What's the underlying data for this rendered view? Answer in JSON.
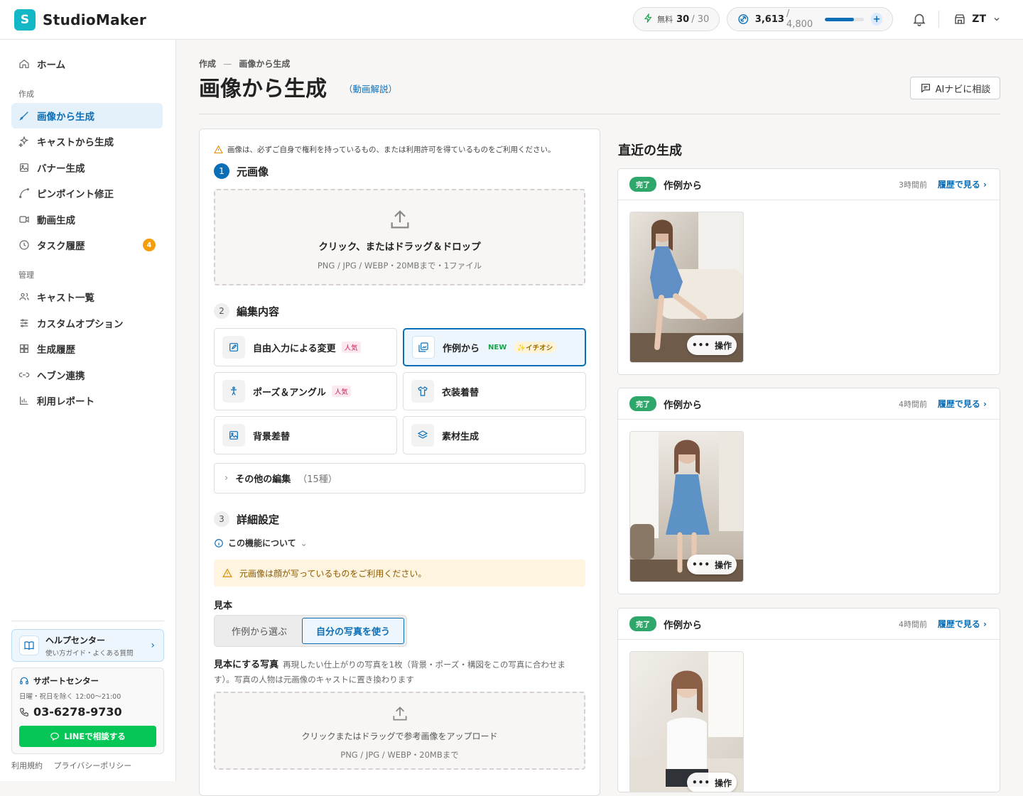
{
  "header": {
    "logo_letter": "S",
    "app_name": "StudioMaker",
    "free_label": "無料",
    "free_used": "30",
    "free_total": "/ 30",
    "credits": "3,613",
    "credits_total": "/ 4,800",
    "credits_fraction": 0.753,
    "user_initials": "ZT"
  },
  "sidebar": {
    "home": "ホーム",
    "section_create": "作成",
    "create_items": [
      "画像から生成",
      "キャストから生成",
      "バナー生成",
      "ピンポイント修正",
      "動画生成",
      "タスク履歴"
    ],
    "task_badge": "4",
    "section_manage": "管理",
    "manage_items": [
      "キャスト一覧",
      "カスタムオプション",
      "生成履歴",
      "ヘブン連携",
      "利用レポート"
    ],
    "help_title": "ヘルプセンター",
    "help_sub": "使い方ガイド・よくある質問",
    "support_title": "サポートセンター",
    "support_hours": "日曜・祝日を除く 12:00〜21:00",
    "support_phone": "03-6278-9730",
    "line_button": "LINEで相談する",
    "footer_terms": "利用規約",
    "footer_privacy": "プライバシーポリシー"
  },
  "page": {
    "breadcrumb_parent": "作成",
    "breadcrumb_sep": "—",
    "breadcrumb_current": "画像から生成",
    "title": "画像から生成",
    "video_link": "（動画解説）",
    "ai_button": "AIナビに相談"
  },
  "form": {
    "notice": "画像は、必ずご自身で権利を持っているもの、または利用許可を得ているものをご利用ください。",
    "step1_num": "1",
    "step1_title": "元画像",
    "dz1_main": "クリック、またはドラッグ＆ドロップ",
    "dz1_sub": "PNG / JPG / WEBP・20MBまで・1ファイル",
    "step2_num": "2",
    "step2_title": "編集内容",
    "opt_free": "自由入力による変更",
    "opt_example": "作例から",
    "opt_pose": "ポーズ＆アングル",
    "opt_outfit": "衣装着替",
    "opt_bg": "背景差替",
    "opt_material": "素材生成",
    "tag_popular": "人気",
    "tag_new": "NEW",
    "tag_pick": "✨イチオシ",
    "more_label": "その他の編集",
    "more_count": "（15種）",
    "step3_num": "3",
    "step3_title": "詳細設定",
    "about": "この機能について",
    "warning": "元画像は顔が写っているものをご利用ください。",
    "sample_label": "見本",
    "seg_pick": "作例から選ぶ",
    "seg_own": "自分の写真を使う",
    "photo_label": "見本にする写真",
    "photo_desc": "再現したい仕上がりの写真を1枚（背景・ポーズ・構図をこの写真に合わせます）。写真の人物は元画像のキャストに置き換わります",
    "dz2_main": "クリックまたはドラッグで参考画像をアップロード",
    "dz2_sub": "PNG / JPG / WEBP・20MBまで"
  },
  "recent": {
    "title": "直近の生成",
    "status": "完了",
    "name": "作例から",
    "link": "履歴で見る",
    "action": "操作",
    "times": [
      "3時間前",
      "4時間前",
      "4時間前"
    ]
  },
  "colors": {
    "accent": "#0b6fb8",
    "brand": "#13b8c6",
    "success": "#2fa66a",
    "line_green": "#06c755",
    "badge": "#f59e0b"
  }
}
